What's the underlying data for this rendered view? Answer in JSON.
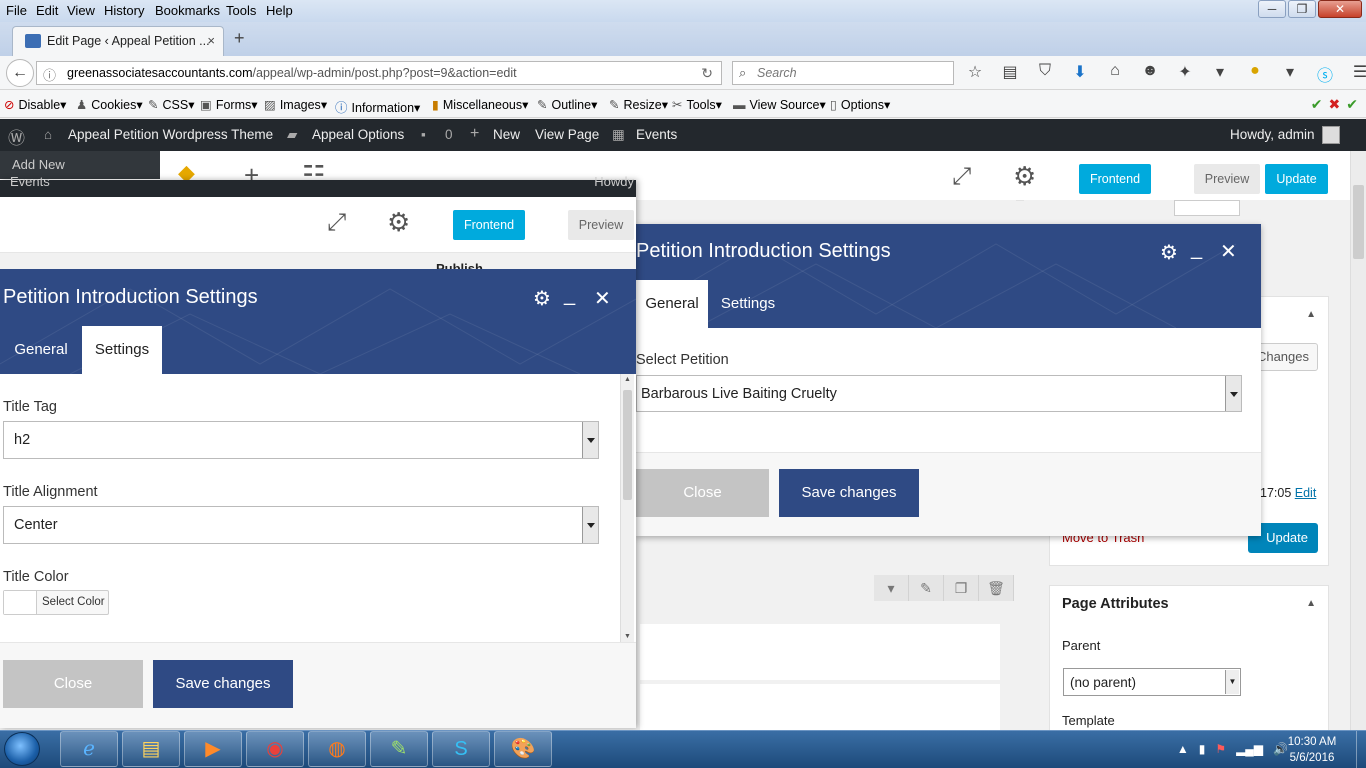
{
  "browser": {
    "menu": [
      "File",
      "Edit",
      "View",
      "History",
      "Bookmarks",
      "Tools",
      "Help"
    ],
    "window_controls": [
      "─",
      "❐",
      "✕"
    ],
    "tab_title": "Edit Page ‹ Appeal Petition ...",
    "tab_close": "×",
    "new_tab": "+",
    "url_domain": "greenassociatesaccountants.com",
    "url_path": "/appeal/wp-admin/post.php?post=9&action=edit",
    "search_placeholder": "Search",
    "webdev_toolbar": [
      "Disable",
      "Cookies",
      "CSS",
      "Forms",
      "Images",
      "Information",
      "Miscellaneous",
      "Outline",
      "Resize",
      "Tools",
      "View Source",
      "Options"
    ]
  },
  "adminbar": {
    "site_name": "Appeal Petition Wordpress Theme",
    "appeal_options": "Appeal Options",
    "comments_count": "0",
    "new_label": "New",
    "view_page": "View Page",
    "events": "Events",
    "howdy": "Howdy, admin"
  },
  "background": {
    "add_new": "Add New",
    "frontend": "Frontend",
    "preview": "Preview",
    "update": "Update",
    "changes": "Changes",
    "publish_time": "17:05",
    "edit_link": "Edit",
    "move_to_trash": "Move to Trash",
    "update_btn": "Update",
    "page_attributes": {
      "title": "Page Attributes",
      "parent_label": "Parent",
      "parent_value": "(no parent)",
      "template_label": "Template"
    }
  },
  "left_window": {
    "top_events": "Events",
    "top_howdy": "Howdy",
    "frontend": "Frontend",
    "preview": "Preview",
    "publish_heading": "Publish",
    "modal": {
      "title": "Petition Introduction Settings",
      "tabs": [
        "General",
        "Settings"
      ],
      "active_tab": "Settings",
      "fields": {
        "title_tag_label": "Title Tag",
        "title_tag_value": "h2",
        "title_alignment_label": "Title Alignment",
        "title_alignment_value": "Center",
        "title_color_label": "Title Color",
        "select_color": "Select Color"
      },
      "close": "Close",
      "save": "Save changes"
    }
  },
  "right_modal": {
    "title": "Petition Introduction Settings",
    "tabs": [
      "General",
      "Settings"
    ],
    "active_tab": "General",
    "select_petition_label": "Select Petition",
    "select_petition_value": "Barbarous Live Baiting Cruelty",
    "close": "Close",
    "save": "Save changes"
  },
  "taskbar": {
    "time": "10:30 AM",
    "date": "5/6/2016"
  },
  "colors": {
    "modal_header": "#2f4a84",
    "frontend_button": "#00aadd",
    "wp_adminbar": "#23282d",
    "wp_update": "#0085ba"
  }
}
